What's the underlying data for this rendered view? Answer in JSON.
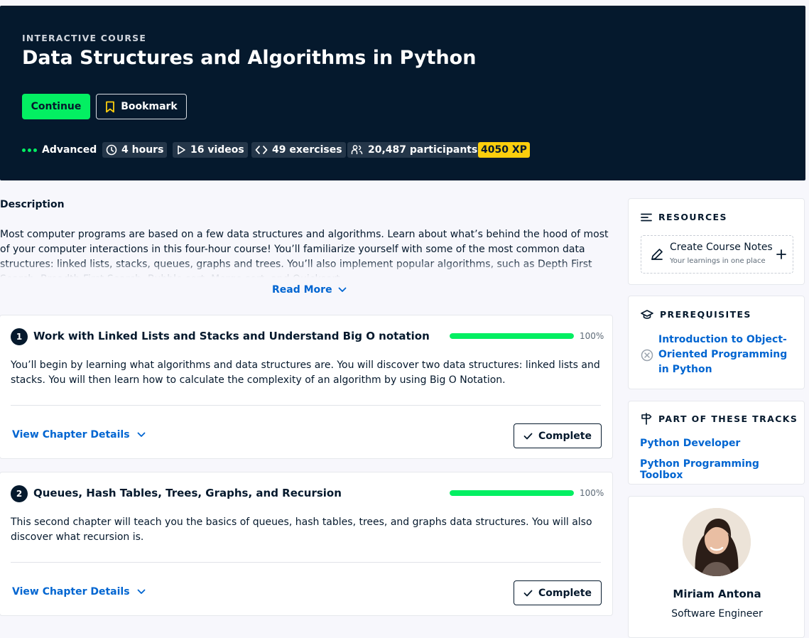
{
  "hero": {
    "eyebrow": "INTERACTIVE COURSE",
    "title": "Data Structures and Algorithms in Python",
    "continue_label": "Continue",
    "bookmark_label": "Bookmark",
    "meta": {
      "level": "Advanced",
      "duration": "4 hours",
      "videos": "16 videos",
      "exercises": "49 exercises",
      "participants": "20,487 participants",
      "xp": "4050 XP"
    }
  },
  "description": {
    "heading": "Description",
    "text": "Most computer programs are based on a few data structures and algorithms. Learn about what’s behind the hood of most of your computer interactions in this four-hour course! You’ll familiarize yourself with some of the most common data structures: linked lists, stacks, queues, graphs and trees. You’ll also implement popular algorithms, such as Depth First Search, Breadth First Search, Bubble sort, Merge sort, and Quicksort.",
    "read_more": "Read More"
  },
  "chapters": [
    {
      "number": "1",
      "title": "Work with Linked Lists and Stacks and Understand Big O notation",
      "progress_pct": 100,
      "progress_label": "100%",
      "description": "You’ll begin by learning what algorithms and data structures are. You will discover two data structures: linked lists and stacks. You will then learn how to calculate the complexity of an algorithm by using Big O Notation.",
      "details_label": "View Chapter Details",
      "status_label": "Complete"
    },
    {
      "number": "2",
      "title": "Queues, Hash Tables, Trees, Graphs, and Recursion",
      "progress_pct": 100,
      "progress_label": "100%",
      "description": "This second chapter will teach you the basics of queues, hash tables, trees, and graphs data structures. You will also discover what recursion is.",
      "details_label": "View Chapter Details",
      "status_label": "Complete"
    }
  ],
  "sidebar": {
    "resources": {
      "heading": "RESOURCES",
      "notes_title": "Create Course Notes",
      "notes_subtitle": "Your learnings in one place"
    },
    "prerequisites": {
      "heading": "PREREQUISITES",
      "link": "Introduction to Object-Oriented Programming in Python"
    },
    "tracks": {
      "heading": "PART OF THESE TRACKS",
      "items": [
        "Python Developer",
        "Python Programming Toolbox"
      ]
    },
    "instructor": {
      "name": "Miriam Antona",
      "role": "Software Engineer"
    }
  },
  "colors": {
    "navy": "#05192d",
    "green": "#03ef62",
    "link_blue": "#0065d1",
    "xp_yellow": "#fcce0d"
  }
}
